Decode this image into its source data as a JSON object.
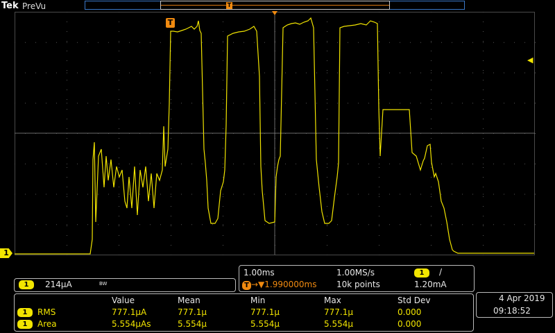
{
  "brand": "Tek",
  "mode": "PreVu",
  "trigger_marker": "T",
  "channel": {
    "number": "1",
    "scale": "214µA",
    "bw_label": "BW",
    "color": "#f2e500"
  },
  "timebase": {
    "scale": "1.00ms",
    "sample_rate": "1.00MS/s",
    "trigger_channel": "1",
    "trigger_slope": "/",
    "trigger_delay": "1.990000ms",
    "record_length": "10k points",
    "trigger_level": "1.20mA"
  },
  "measurements": {
    "headers": [
      "Value",
      "Mean",
      "Min",
      "Max",
      "Std Dev"
    ],
    "rows": [
      {
        "ch": "1",
        "name": "RMS",
        "value": "777.1µA",
        "mean": "777.1µ",
        "min": "777.1µ",
        "max": "777.1µ",
        "std": "0.000"
      },
      {
        "ch": "1",
        "name": "Area",
        "value": "5.554µAs",
        "mean": "5.554µ",
        "min": "5.554µ",
        "max": "5.554µ",
        "std": "0.000"
      }
    ]
  },
  "datetime": {
    "date": "4 Apr  2019",
    "time": "09:18:52"
  },
  "colors": {
    "accent": "#f2e500",
    "trigger": "#f08a10",
    "grid": "#505050",
    "record_bar": "#3a78c8"
  }
}
